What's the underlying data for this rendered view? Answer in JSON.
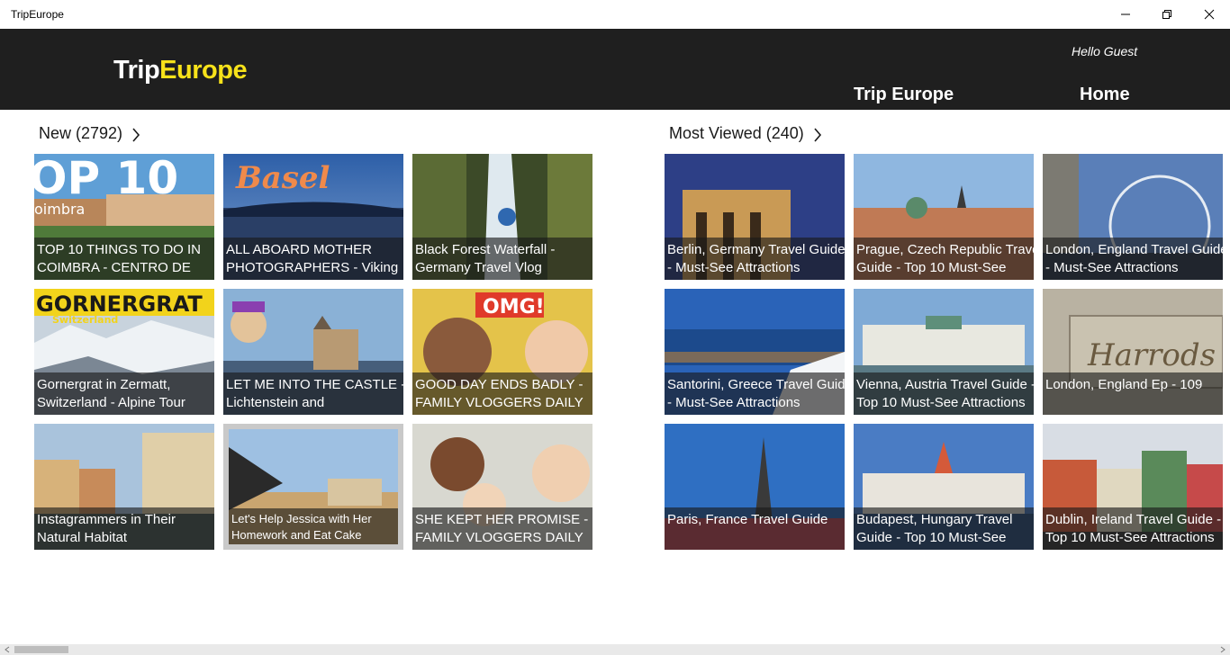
{
  "window": {
    "title": "TripEurope"
  },
  "header": {
    "logo_part1": "Trip",
    "logo_part2": "Europe",
    "greeting": "Hello Guest",
    "nav": [
      "Trip Europe",
      "Home"
    ]
  },
  "sections": [
    {
      "label": "New (2792)",
      "tiles": [
        {
          "line1": "TOP 10 THINGS TO DO IN",
          "line2": "COIMBRA - CENTRO DE",
          "art": "top10"
        },
        {
          "line1": "ALL ABOARD MOTHER",
          "line2": "PHOTOGRAPHERS - Viking",
          "art": "basel"
        },
        {
          "line1": "Black Forest Waterfall -",
          "line2": "Germany Travel Vlog",
          "art": "waterfall"
        },
        {
          "line1": "Gornergrat in Zermatt,",
          "line2": "Switzerland - Alpine Tour",
          "art": "gornergrat"
        },
        {
          "line1": "LET ME INTO THE CASTLE -",
          "line2": "Lichtenstein and",
          "art": "castle"
        },
        {
          "line1": "GOOD DAY ENDS BADLY -",
          "line2": "FAMILY VLOGGERS DAILY",
          "art": "omg"
        },
        {
          "line1": "Instagrammers in Their",
          "line2": "Natural Habitat",
          "art": "colmar"
        },
        {
          "line1": "Let's Help Jessica with Her",
          "line2": "Homework and Eat Cake",
          "art": "jessica"
        },
        {
          "line1": "SHE KEPT HER PROMISE -",
          "line2": "FAMILY VLOGGERS DAILY",
          "art": "family"
        }
      ]
    },
    {
      "label": "Most Viewed (240)",
      "tiles": [
        {
          "line1": "Berlin, Germany Travel Guide",
          "line2": "- Must-See Attractions",
          "art": "berlin"
        },
        {
          "line1": "Prague, Czech Republic Travel",
          "line2": "Guide - Top 10 Must-See",
          "art": "prague"
        },
        {
          "line1": "London, England Travel Guide",
          "line2": "- Must-See Attractions",
          "art": "londoneye"
        },
        {
          "line1": "Santorini, Greece Travel Guide",
          "line2": "- Must-See Attractions",
          "art": "santorini"
        },
        {
          "line1": "Vienna, Austria Travel Guide -",
          "line2": "Top 10 Must-See Attractions",
          "art": "vienna"
        },
        {
          "line1": "London, England Ep - 109",
          "line2": "",
          "art": "harrods"
        },
        {
          "line1": "Paris, France Travel Guide",
          "line2": "",
          "art": "paris"
        },
        {
          "line1": "Budapest, Hungary Travel",
          "line2": "Guide - Top 10 Must-See",
          "art": "budapest"
        },
        {
          "line1": "Dublin, Ireland Travel Guide -",
          "line2": "Top 10 Must-See Attractions",
          "art": "dublin"
        }
      ]
    }
  ],
  "colors": {
    "header_bg": "#1f1f1f",
    "logo_accent": "#f7e21a"
  }
}
